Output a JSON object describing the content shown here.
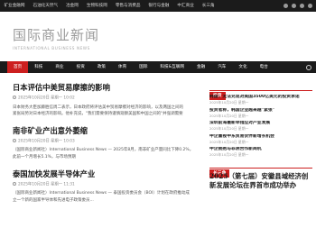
{
  "topbar": {
    "links": [
      "矿业金融网",
      "石油化天然气",
      "冶金网",
      "生物科技网",
      "零售与消费品",
      "银行与金融",
      "中汇商业",
      "长三角"
    ],
    "icons": [
      "social-icon",
      "social-icon",
      "social-icon",
      "social-icon"
    ]
  },
  "masthead": {
    "title": "国际商业新闻",
    "subtitle": "INTERNATIONAL BUSINESS NEWS"
  },
  "nav": {
    "items": [
      "首页",
      "科技",
      "商业",
      "投资",
      "政策",
      "体育",
      "国际",
      "科技&互联网",
      "金融",
      "汽车",
      "文化",
      "电台"
    ],
    "active_index": 0
  },
  "articles": [
    {
      "title": "日本评估中美贸易摩擦的影响",
      "date": "2025年10月20日",
      "author": "星期一 10:02",
      "excerpt": [
        "日本财务大臣加藤胜信周二表示，日本政府将评估美中贸易摩擦对经济的影响，以及两国之间的",
        "紧张局势对日本经济的影响。他补充说，\"我们需要保持谨慎观察美国和中国之间的\"并强调需要"
      ]
    },
    {
      "title": "南非矿业产出意外萎缩",
      "date": "2025年10月20日",
      "author": "星期一 10:03",
      "excerpt": [
        "（国际商业新闻社）International Business News — 2025年8月，南非矿业产量同比下降0.2%，",
        "此前一个月增长5.1%，与市场预期"
      ]
    },
    {
      "title": "泰国加快发展半导体产业",
      "date": "2025年10月20日",
      "author": "星期一 11:31",
      "excerpt": [
        "（国际商业新闻社）International Business News — 泰国投资委员会（BOI）计划在政府推动成",
        "立一个新的国家半导体和先进电子政策委员..."
      ]
    }
  ],
  "sidebar": {
    "head1": "投资",
    "items": [
      {
        "title": "韩国：无法兑现对美国3500亿美元的投资承诺",
        "date": "2025年10月20日 星期一"
      },
      {
        "title": "投资者称，韩国企业越来越\"紧张\"",
        "date": "2025年10月20日 星期一"
      },
      {
        "title": "深圳前海最新举措应对产业发展",
        "date": "2025年10月20日 星期一"
      },
      {
        "title": "中企重视中东贸易伙伴新增长机会",
        "date": "2025年10月20日 星期一"
      },
      {
        "title": "中企拥抱与非洲合作新商机",
        "date": "2025年10月20日 星期一"
      }
    ],
    "head2": "长三角",
    "feature": [
      "2025（第七届）安徽县域经济创",
      "新发展论坛在界首市成功举办"
    ]
  }
}
